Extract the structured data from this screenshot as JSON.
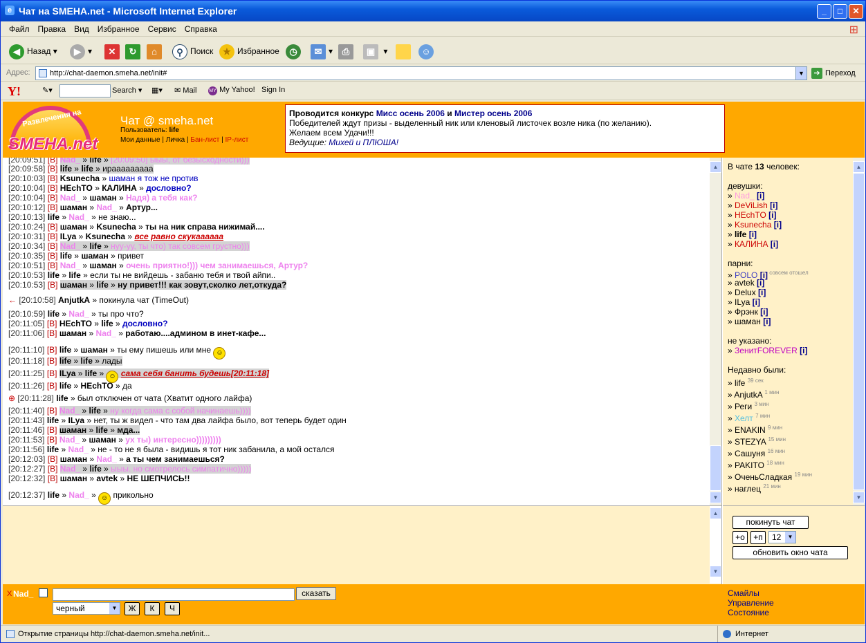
{
  "window": {
    "title": "Чат на SMEHA.net - Microsoft Internet Explorer"
  },
  "menu": [
    "Файл",
    "Правка",
    "Вид",
    "Избранное",
    "Сервис",
    "Справка"
  ],
  "toolbar": {
    "back": "Назад",
    "search": "Поиск",
    "favorites": "Избранное"
  },
  "address": {
    "label": "Адрес:",
    "url": "http://chat-daemon.smeha.net/init#",
    "go": "Переход"
  },
  "yahoo": {
    "logo": "Y!",
    "search": "Search",
    "mail": "Mail",
    "myyahoo": "My Yahoo!",
    "signin": "Sign In"
  },
  "header": {
    "logo_top": "Развлечения на",
    "logo_bottom": "SMEHA.net",
    "title": "Чат @ smeha.net",
    "user_label": "Пользователь:",
    "user": "life",
    "link1": "Мои данные",
    "link2": "Личка",
    "link3": "Бан-лист",
    "link4": "IP-лист"
  },
  "announce": {
    "l1a": "Проводится конкурс ",
    "l1b": "Мисс осень 2006",
    "l1c": " и ",
    "l1d": "Мистер осень 2006",
    "l2": "Победителей ждут призы - выделенный ник или кленовый листочек возле ника (по желанию).",
    "l3": "Желаем всем Удачи!!!",
    "l4a": "Ведущие: ",
    "l4b": "Михей и ПЛЮША!"
  },
  "chat": [
    {
      "t": "[20:09:51]",
      "b": "[В]",
      "from": "Nad_",
      "to": "life",
      "msg": "[20:09:50] ыыы, от безысходности)))",
      "fc": "pink",
      "mc": "pink",
      "hl": true
    },
    {
      "t": "[20:09:58]",
      "b": "[В]",
      "from": "life",
      "to": "life",
      "msg": "ирааааааааа",
      "hl": true
    },
    {
      "t": "[20:10:03]",
      "b": "[В]",
      "from": "Ksunecha",
      "to": "",
      "msg": "шаман я тож не против",
      "mc": "blue-n"
    },
    {
      "t": "[20:10:04]",
      "b": "[В]",
      "from": "HEchTO",
      "to": "КАЛИНА",
      "msg": "дословно?",
      "mc": "blue"
    },
    {
      "t": "[20:10:04]",
      "b": "[В]",
      "from": "Nad_",
      "to": "шаман",
      "msg": "Надя) а тебя как?",
      "fc": "pink",
      "mc": "pinkb"
    },
    {
      "t": "[20:10:12]",
      "b": "[В]",
      "from": "шаман",
      "to": "Nad_",
      "msg": "Артур...",
      "tc": "pink",
      "mc": "bold"
    },
    {
      "t": "[20:10:13]",
      "b": "",
      "from": "life",
      "to": "Nad_",
      "msg": "не знаю...",
      "tc": "pink"
    },
    {
      "t": "[20:10:24]",
      "b": "[В]",
      "from": "шаман",
      "to": "Ksunecha",
      "msg": "ты на ник справа нижимай....",
      "mc": "bold"
    },
    {
      "t": "[20:10:31]",
      "b": "[В]",
      "from": "ILya",
      "to": "Ksunecha",
      "msg": "все равно скукаааааа",
      "mc": "redu"
    },
    {
      "t": "[20:10:34]",
      "b": "[В]",
      "from": "Nad_",
      "to": "life",
      "msg": "нуу-уу, ты что) так совсем грустно)))",
      "fc": "pink",
      "mc": "pink",
      "hl": true
    },
    {
      "t": "[20:10:35]",
      "b": "[В]",
      "from": "life",
      "to": "шаман",
      "msg": "привет"
    },
    {
      "t": "[20:10:51]",
      "b": "[В]",
      "from": "Nad_",
      "to": "шаман",
      "msg": "очень приятно!))) чем занимаешься, Артур?",
      "fc": "pink",
      "mc": "pinkb"
    },
    {
      "t": "[20:10:53]",
      "b": "",
      "from": "life",
      "to": "life",
      "msg": "если ты не вийдешь - забаню тебя и твой айпи.."
    },
    {
      "t": "[20:10:53]",
      "b": "[В]",
      "from": "шаман",
      "to": "life",
      "msg": "ну привет!!! как зовут,сколко лет,откуда?",
      "mc": "bold",
      "hl": true
    },
    {
      "t": "[20:10:58]",
      "b": "",
      "from": "AnjutkA",
      "to": "",
      "msg": "покинула чат (TimeOut)",
      "sys": "leave"
    },
    {
      "t": "[20:10:59]",
      "b": "",
      "from": "life",
      "to": "Nad_",
      "msg": "ты про что?",
      "tc": "pink"
    },
    {
      "t": "[20:11:05]",
      "b": "[В]",
      "from": "HEchTO",
      "to": "life",
      "msg": "дословно?",
      "mc": "blue"
    },
    {
      "t": "[20:11:06]",
      "b": "[В]",
      "from": "шаман",
      "to": "Nad_",
      "msg": "работаю....админом в инет-кафе...",
      "tc": "pink",
      "mc": "bold"
    },
    {
      "t": "[20:11:10]",
      "b": "[В]",
      "from": "life",
      "to": "шаман",
      "msg": "ты ему пишешь или мне",
      "smile": "after"
    },
    {
      "t": "[20:11:18]",
      "b": "[В]",
      "from": "life",
      "to": "life",
      "msg": "лады",
      "hl": true
    },
    {
      "t": "[20:11:25]",
      "b": "[В]",
      "from": "ILya",
      "to": "life",
      "msg": "сама себя банить будешь[20:11:18]",
      "mc": "redu",
      "smile": "before",
      "hl": true
    },
    {
      "t": "[20:11:26]",
      "b": "[В]",
      "from": "life",
      "to": "HEchTO",
      "msg": "да"
    },
    {
      "t": "[20:11:28]",
      "b": "",
      "from": "life",
      "to": "",
      "msg": "был отключен от чата (Хватит одного лайфа)",
      "sys": "kick"
    },
    {
      "t": "[20:11:40]",
      "b": "[В]",
      "from": "Nad_",
      "to": "life",
      "msg": "ну когда сама с собой начинаешь))))",
      "fc": "pink",
      "mc": "pink",
      "hl": true
    },
    {
      "t": "[20:11:43]",
      "b": "",
      "from": "life",
      "to": "ILya",
      "msg": "нет, ты ж видел - что там два лайфа было, вот теперь будет один"
    },
    {
      "t": "[20:11:46]",
      "b": "[В]",
      "from": "шаман",
      "to": "life",
      "msg": "мда...",
      "mc": "bold",
      "hl": true
    },
    {
      "t": "[20:11:53]",
      "b": "[В]",
      "from": "Nad_",
      "to": "шаман",
      "msg": "ух ты) интересно)))))))))",
      "fc": "pink",
      "mc": "pinkb"
    },
    {
      "t": "[20:11:56]",
      "b": "",
      "from": "life",
      "to": "Nad_",
      "msg": "не - то не я была - видишь я тот ник забанила, а мой остался",
      "tc": "pink"
    },
    {
      "t": "[20:12:03]",
      "b": "[В]",
      "from": "шаман",
      "to": "Nad_",
      "msg": "а ты чем занимаешься?",
      "tc": "pink",
      "mc": "bold"
    },
    {
      "t": "[20:12:27]",
      "b": "[В]",
      "from": "Nad_",
      "to": "life",
      "msg": "ыыы. но смотрелось симпатично)))))",
      "fc": "pink",
      "mc": "pink",
      "hl": true
    },
    {
      "t": "[20:12:32]",
      "b": "[В]",
      "from": "шаман",
      "to": "avtek",
      "msg": "НЕ ШЕПЧИСЬ!!",
      "mc": "bold"
    },
    {
      "t": "[20:12:37]",
      "b": "",
      "from": "life",
      "to": "Nad_",
      "msg": "прикольно",
      "tc": "pink",
      "smile": "before"
    }
  ],
  "users": {
    "count_pre": "В чате ",
    "count": "13",
    "count_post": " человек:",
    "girls_label": "девушки:",
    "girls": [
      {
        "n": "Nad_",
        "c": "#ff9adf"
      },
      {
        "n": "DeViLish",
        "c": "#c00"
      },
      {
        "n": "HEchTO",
        "c": "#c00"
      },
      {
        "n": "Ksunecha",
        "c": "#c00"
      },
      {
        "n": "life",
        "c": "#000",
        "b": true
      },
      {
        "n": "КАЛИНА",
        "c": "#c00"
      }
    ],
    "boys_label": "парни:",
    "boys": [
      {
        "n": "POLO",
        "c": "#4040c0",
        "note": "совсем отошел"
      },
      {
        "n": "avtek",
        "c": "#000"
      },
      {
        "n": "Delux",
        "c": "#000"
      },
      {
        "n": "ILya",
        "c": "#000"
      },
      {
        "n": "Фрэнк",
        "c": "#000"
      },
      {
        "n": "шаман",
        "c": "#000"
      }
    ],
    "unknown_label": "не указано:",
    "unknown": [
      {
        "n": "ЗенитFOREVER",
        "c": "#c000c0"
      }
    ],
    "info": "[i]",
    "recent_label": "Недавно были:",
    "recent": [
      {
        "n": "life",
        "t": "39 сек"
      },
      {
        "n": "AnjutkA",
        "t": "1 мин"
      },
      {
        "n": "Реги",
        "t": "3 мин"
      },
      {
        "n": "Хелт",
        "t": "7 мин"
      },
      {
        "n": "ENAKIN",
        "t": "9 мин"
      },
      {
        "n": "STEZYA",
        "t": "15 мин"
      },
      {
        "n": "Сашуня",
        "t": "16 мин"
      },
      {
        "n": "PAKITO",
        "t": "18 мин"
      },
      {
        "n": "ОченьСладкая",
        "t": "19 мин"
      },
      {
        "n": "наглец",
        "t": "21 мин"
      }
    ]
  },
  "controls": {
    "leave": "покинуть чат",
    "plus_o": "+о",
    "plus_p": "+п",
    "size": "12",
    "refresh": "обновить окно чата"
  },
  "bottom": {
    "x": "X",
    "nick": "Nad_",
    "say": "сказать",
    "color": "черный",
    "bold": "Ж",
    "italic": "К",
    "underline": "Ч",
    "links": [
      "Смайлы",
      "Управление",
      "Состояние"
    ]
  },
  "status": {
    "text": "Открытие страницы http://chat-daemon.smeha.net/init...",
    "zone": "Интернет"
  }
}
